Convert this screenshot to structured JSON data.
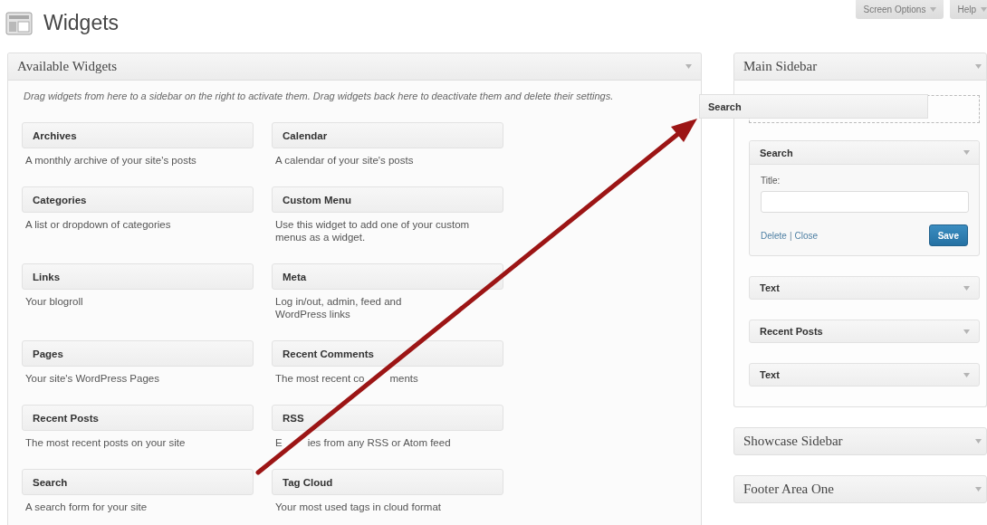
{
  "page_title": "Widgets",
  "header_buttons": [
    {
      "label": "Screen Options"
    },
    {
      "label": "Help"
    }
  ],
  "available_widgets": {
    "title": "Available Widgets",
    "description": "Drag widgets from here to a sidebar on the right to activate them. Drag widgets back here to deactivate them and delete their settings.",
    "widgets": [
      {
        "name": "Archives",
        "description": "A monthly archive of your site's posts"
      },
      {
        "name": "Calendar",
        "description": "A calendar of your site's posts"
      },
      {
        "name": "Categories",
        "description": "A list or dropdown of categories"
      },
      {
        "name": "Custom Menu",
        "description": "Use this widget to add one of your custom menus as a widget."
      },
      {
        "name": "Links",
        "description": "Your blogroll"
      },
      {
        "name": "Meta",
        "description": "Log in/out, admin, feed and WordPress links"
      },
      {
        "name": "Pages",
        "description": "Your site's WordPress Pages"
      },
      {
        "name": "Recent Comments",
        "description": [
          "The most recent co",
          "ments"
        ]
      },
      {
        "name": "Recent Posts",
        "description": "The most recent posts on your site"
      },
      {
        "name": "RSS",
        "description": [
          "E",
          "ies from any RSS or Atom feed"
        ]
      },
      {
        "name": "Search",
        "description": "A search form for your site"
      },
      {
        "name": "Tag Cloud",
        "description": "Your most used tags in cloud format"
      }
    ]
  },
  "dragged_widget": {
    "name": "Search"
  },
  "sidebars": [
    {
      "title": "Main Sidebar",
      "expanded": true,
      "widgets": [
        {
          "name": "Search",
          "expanded": true,
          "form": {
            "field_label": "Title:",
            "links": [
              {
                "label": "Delete"
              },
              {
                "label": "Close"
              }
            ],
            "separator": "|",
            "save": "Save"
          }
        },
        {
          "name": "Text",
          "expanded": false
        },
        {
          "name": "Recent Posts",
          "expanded": false
        },
        {
          "name": "Text",
          "expanded": false
        }
      ]
    },
    {
      "title": "Showcase Sidebar",
      "expanded": false
    },
    {
      "title": "Footer Area One",
      "expanded": false
    }
  ]
}
